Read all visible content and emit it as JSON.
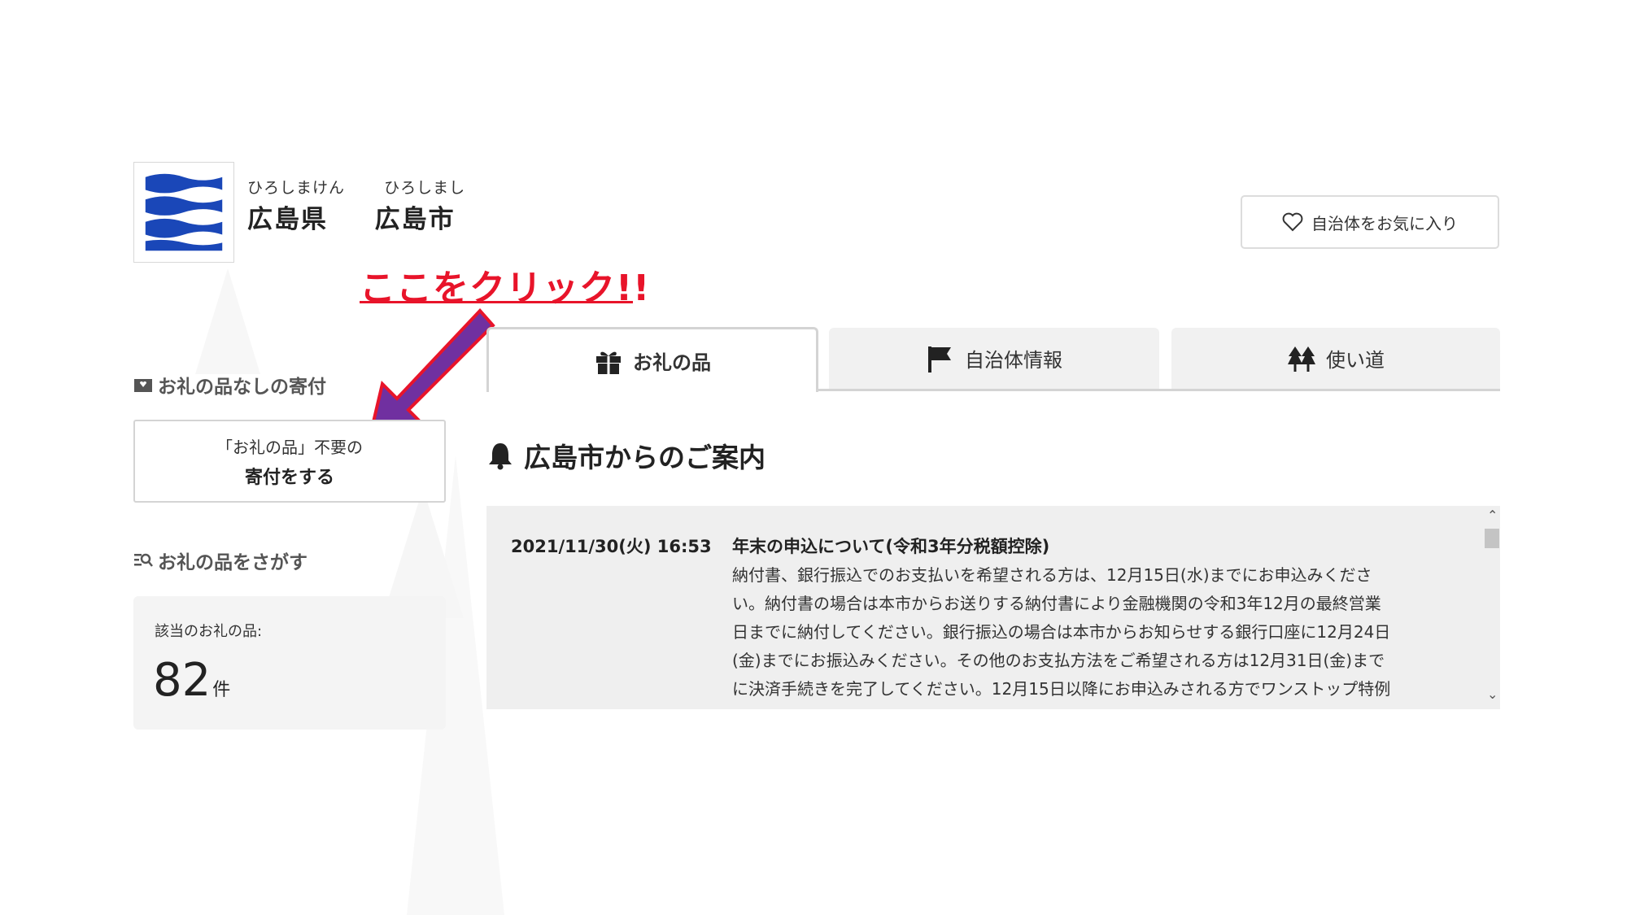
{
  "header": {
    "reading_pref": "ひろしまけん",
    "reading_city": "ひろしまし",
    "pref_name": "広島県",
    "city_name": "広島市",
    "favorite_label": "自治体をお気に入り",
    "logo_colors": [
      "#1a47b8",
      "#ffffff"
    ]
  },
  "annotation": {
    "text": "ここをクリック!!",
    "color": "#e8142a",
    "arrow_color": "#7030a0"
  },
  "sidebar": {
    "no_gift_title": "お礼の品なしの寄付",
    "no_gift_button_line1": "「お礼の品」不要の",
    "no_gift_button_line2": "寄付をする",
    "search_title": "お礼の品をさがす",
    "count_label": "該当のお礼の品:",
    "count_value": "82",
    "count_unit": "件"
  },
  "tabs": [
    {
      "label": "お礼の品",
      "icon": "gift-icon",
      "active": true
    },
    {
      "label": "自治体情報",
      "icon": "flag-icon",
      "active": false
    },
    {
      "label": "使い道",
      "icon": "trees-icon",
      "active": false
    }
  ],
  "section": {
    "title": "広島市からのご案内",
    "icon": "bell-icon"
  },
  "news": [
    {
      "date": "2021/11/30(火) 16:53",
      "title": "年末の申込について(令和3年分税額控除)",
      "body_lines": [
        "納付書、銀行振込でのお支払いを希望される方は、12月15日(水)までにお申込みくださ",
        "い。納付書の場合は本市からお送りする納付書により金融機関の令和3年12月の最終営業",
        "日までに納付してください。銀行振込の場合は本市からお知らせする銀行口座に12月24日",
        "(金)までにお振込みください。その他のお支払方法をご希望される方は12月31日(金)まで",
        "に決済手続きを完了してください。12月15日以降にお申込みされる方でワンストップ特例"
      ]
    }
  ]
}
